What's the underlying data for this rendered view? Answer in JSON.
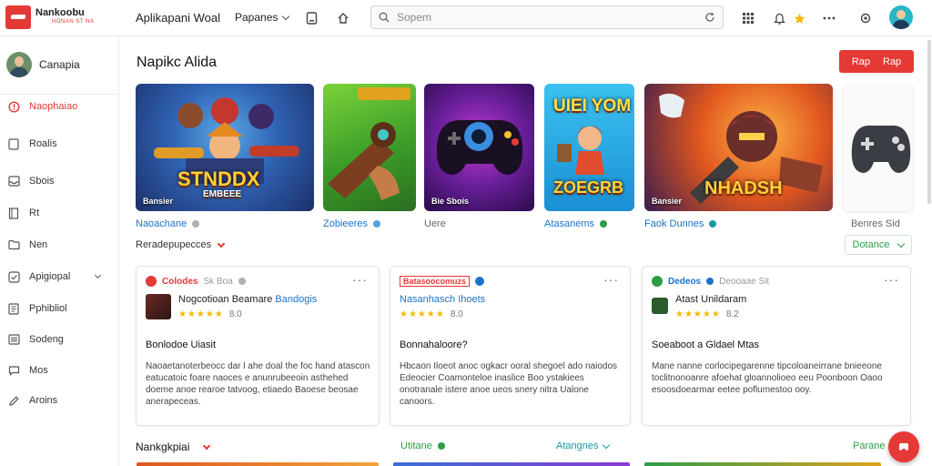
{
  "logo": {
    "text": "Nankoobu",
    "sub": "HONAN ST NA"
  },
  "header": {
    "app_title": "Aplikapani Woal",
    "pages_label": "Papanes",
    "search_placeholder": "Sopem"
  },
  "sidebar": {
    "user_name": "Canapia",
    "items": [
      {
        "label": "Naophaiao",
        "icon": "alert-circle-icon",
        "active": true
      },
      {
        "label": "Roalis",
        "icon": "file-icon"
      },
      {
        "label": "Sbois",
        "icon": "inbox-icon"
      },
      {
        "label": "Rt",
        "icon": "book-icon"
      },
      {
        "label": "Nen",
        "icon": "folder-icon"
      },
      {
        "label": "Apigiopal",
        "icon": "settings-icon",
        "has_chevron": true
      },
      {
        "label": "Pphibliol",
        "icon": "document-icon"
      },
      {
        "label": "Sodeng",
        "icon": "list-icon"
      },
      {
        "label": "Mos",
        "icon": "chat-icon"
      },
      {
        "label": "Aroins",
        "icon": "edit-icon"
      }
    ]
  },
  "main": {
    "section_title": "Napikc Alida",
    "red_button": {
      "left": "Rap",
      "right": "Rap"
    },
    "banners": [
      {
        "label": "Bansier",
        "title": "STNDDX",
        "subtitle": "EMBEEE",
        "caption": "Naoachane"
      },
      {
        "label": "",
        "title": "",
        "subtitle": "",
        "caption": "Zobieeres"
      },
      {
        "label": "Bie Sbois",
        "title": "",
        "subtitle": "",
        "caption": "Uere"
      },
      {
        "label": "",
        "title": "UIEI YOM",
        "subtitle": "ZOEGRB",
        "caption": "Atasanems"
      },
      {
        "label": "Bansier",
        "title": "NHADSH",
        "subtitle": "",
        "caption": "Faok Dunnes"
      },
      {
        "label": "",
        "title": "",
        "subtitle": "",
        "caption": "Benres Sid"
      }
    ],
    "recommended_label": "Reradepupecces",
    "green_select": "Dotance",
    "cards": [
      {
        "source": "Colodes",
        "meta": "Sk Boa",
        "game_name": "Nogcotioan Beamare",
        "game_tag": "Bandogis",
        "rating": "8.0",
        "title": "Bonlodoe Uiasit",
        "body": "Naoaetanoterbeocc dar l ahe doal the foc hand atascon eatucatoic foare naoces e anunrubeeoin asthehed doeme anoe rearoe tatvoog, etiaedo Baoese beosae anerapeceas."
      },
      {
        "source": "Batasoocomuzs",
        "meta": "",
        "game_name": "Nasanhasch Ihoets",
        "game_tag": "",
        "rating": "8.0",
        "title": "Bonnahaloore?",
        "body": "Hbcaon Iloeot anoc ogkacr ooral shegoel ado naiodos Edeocier Coamonteloe inaslice Boo ystakiees onotranale istere anoe ueos snery nitra Ualone canoors."
      },
      {
        "source": "Dedeos",
        "meta": "Deooaae Sit",
        "game_name": "Atast Unildaram",
        "game_tag": "",
        "rating": "8.2",
        "title": "Soeaboot a Gldael Mtas",
        "body": "Mane nanne corlocipegarenne tipcoloaneirrane bnieeone toclitnonoanre afoehat gloannolioeo eeu Poonboon Oaoo esoosdoearmar eetee poflumestoo ooy."
      }
    ],
    "bottom": {
      "left": "Nankgkpiai",
      "mid1": "Utitane",
      "mid2": "Atangnes",
      "right": "Parane"
    }
  },
  "colors": {
    "accent": "#e53935",
    "success": "#2e9d48",
    "link": "#1a73c8"
  }
}
